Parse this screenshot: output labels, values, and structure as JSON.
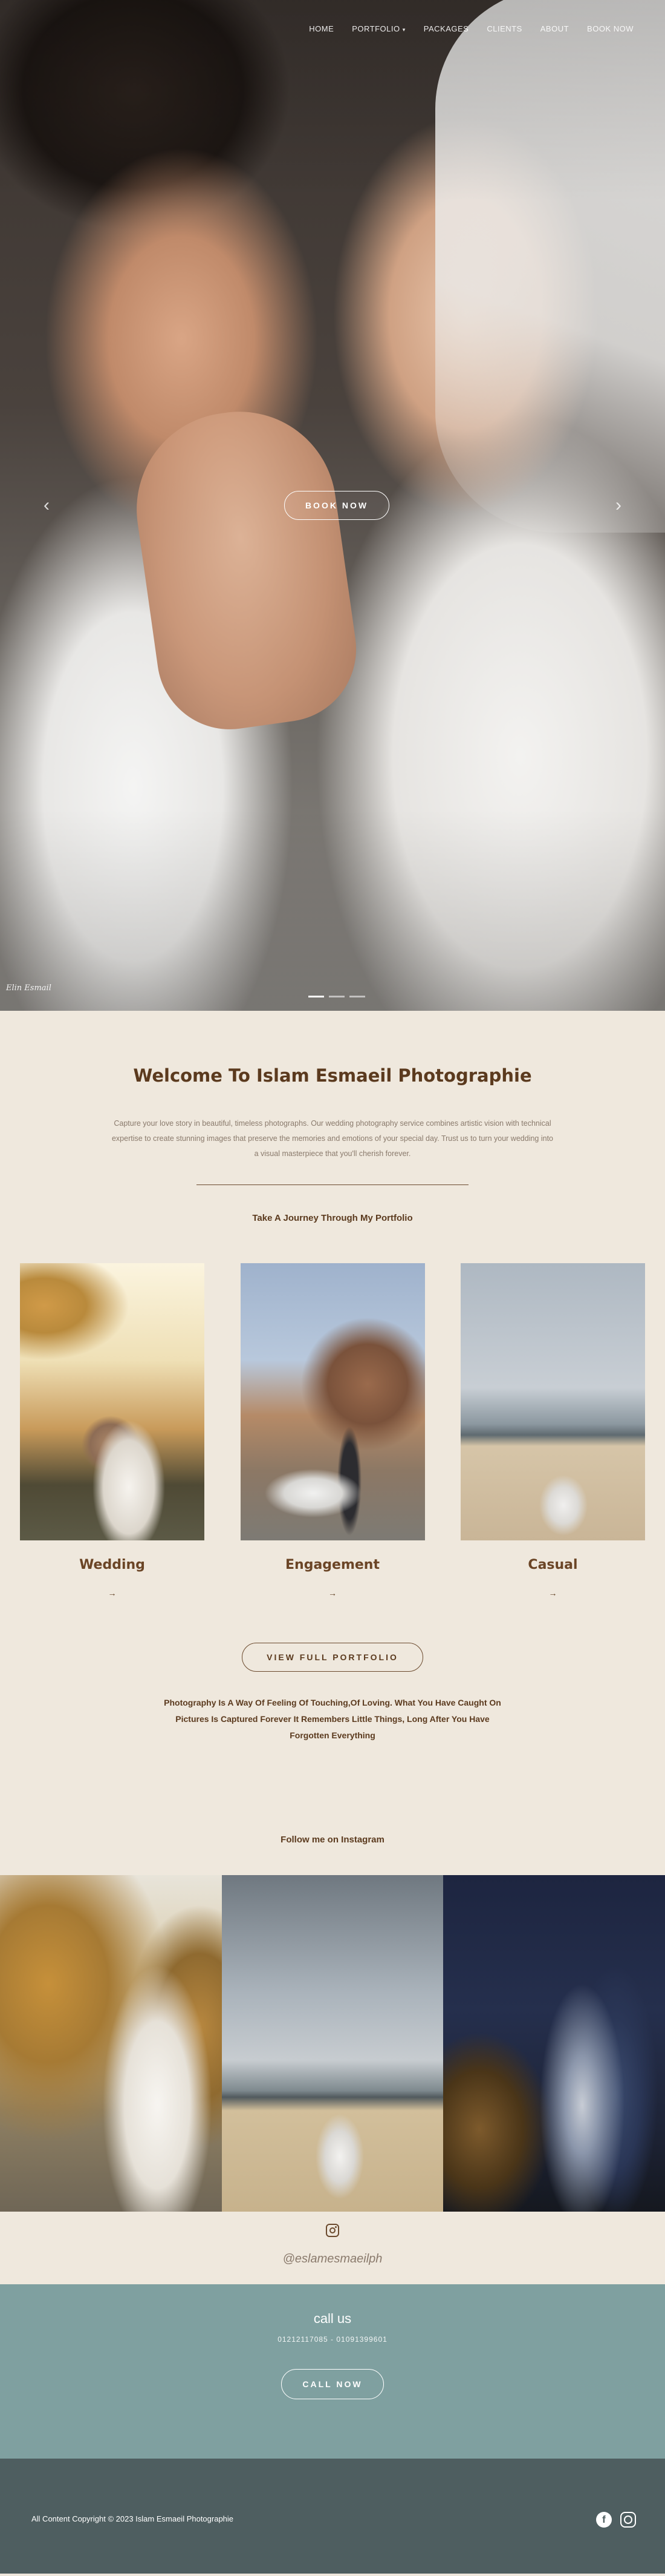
{
  "nav": {
    "items": [
      {
        "label": "HOME"
      },
      {
        "label": "PORTFOLIO"
      },
      {
        "label": "PACKAGES"
      },
      {
        "label": "CLIENTS"
      },
      {
        "label": "ABOUT"
      },
      {
        "label": "BOOK NOW"
      }
    ],
    "portfolio_caret": "▾"
  },
  "hero": {
    "book_button": "BOOK NOW",
    "prev_arrow": "‹",
    "next_arrow": "›",
    "signature": "Elin Esmail"
  },
  "welcome": {
    "title": "Welcome To Islam Esmaeil Photographie",
    "description": "Capture your love story in beautiful, timeless photographs. Our wedding photography service combines artistic vision with technical expertise to create stunning images that preserve the memories and emotions of your special day. Trust us to turn your wedding into a visual masterpiece that you'll cherish forever.",
    "journey": "Take A Journey Through My Portfolio"
  },
  "portfolio": {
    "cards": [
      {
        "title": "Wedding",
        "arrow": "→"
      },
      {
        "title": "Engagement",
        "arrow": "→"
      },
      {
        "title": "Casual",
        "arrow": "→"
      }
    ],
    "full_button": "VIEW FULL PORTFOLIO",
    "quote": "Photography Is A Way Of Feeling Of Touching,Of Loving. What You Have Caught On Pictures Is Captured Forever It Remembers Little Things, Long After You Have Forgotten Everything"
  },
  "instagram": {
    "heading": "Follow me on Instagram",
    "handle": "@eslamesmaeilph"
  },
  "call": {
    "title": "call us",
    "phones": "01212117085 - 01091399601",
    "button": "CALL NOW"
  },
  "footer": {
    "copyright": "All Content Copyright © 2023 Islam Esmaeil Photographie",
    "facebook_glyph": "f"
  },
  "colors": {
    "background": "#efe8dd",
    "brown": "#5b3a1e",
    "call_bg": "#7fa0a0",
    "footer_bg": "#4e5e60"
  }
}
